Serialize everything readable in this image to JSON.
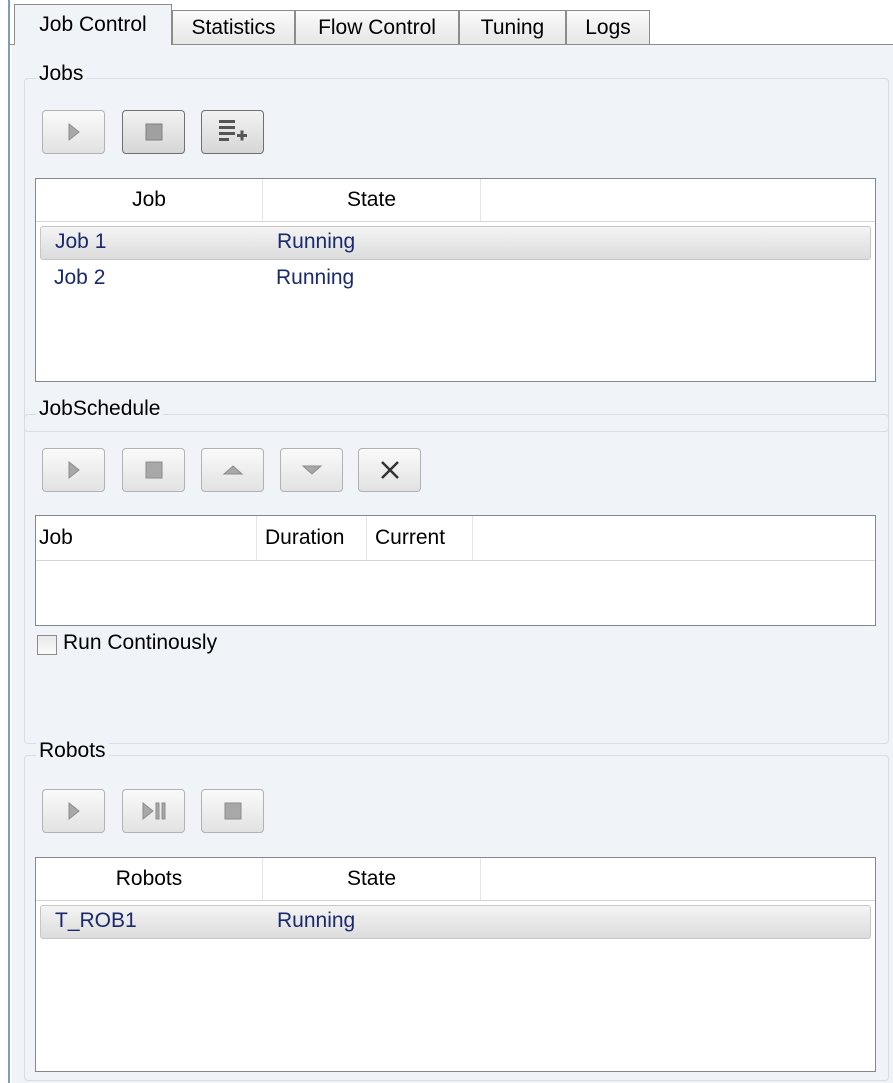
{
  "tabs": [
    {
      "label": "Job Control"
    },
    {
      "label": "Statistics"
    },
    {
      "label": "Flow Control"
    },
    {
      "label": "Tuning"
    },
    {
      "label": "Logs"
    }
  ],
  "jobs": {
    "title": "Jobs",
    "columns": [
      "Job",
      "State"
    ],
    "rows": [
      {
        "job": "Job 1",
        "state": "Running"
      },
      {
        "job": "Job 2",
        "state": "Running"
      }
    ],
    "icons": [
      "play-icon",
      "stop-icon",
      "add-list-icon"
    ]
  },
  "schedule": {
    "title": "JobSchedule",
    "columns": [
      "Job",
      "Duration",
      "Current"
    ],
    "checkbox_label": "Run Continously",
    "icons": [
      "play-icon",
      "stop-icon",
      "move-up-icon",
      "move-down-icon",
      "delete-icon"
    ]
  },
  "robots": {
    "title": "Robots",
    "columns": [
      "Robots",
      "State"
    ],
    "rows": [
      {
        "robot": "T_ROB1",
        "state": "Running"
      }
    ],
    "icons": [
      "play-icon",
      "step-icon",
      "stop-icon"
    ]
  },
  "colors": {
    "panel": "#f0f3f7",
    "row_text": "#1a2a6c",
    "group_border": "#d5dfe5"
  }
}
